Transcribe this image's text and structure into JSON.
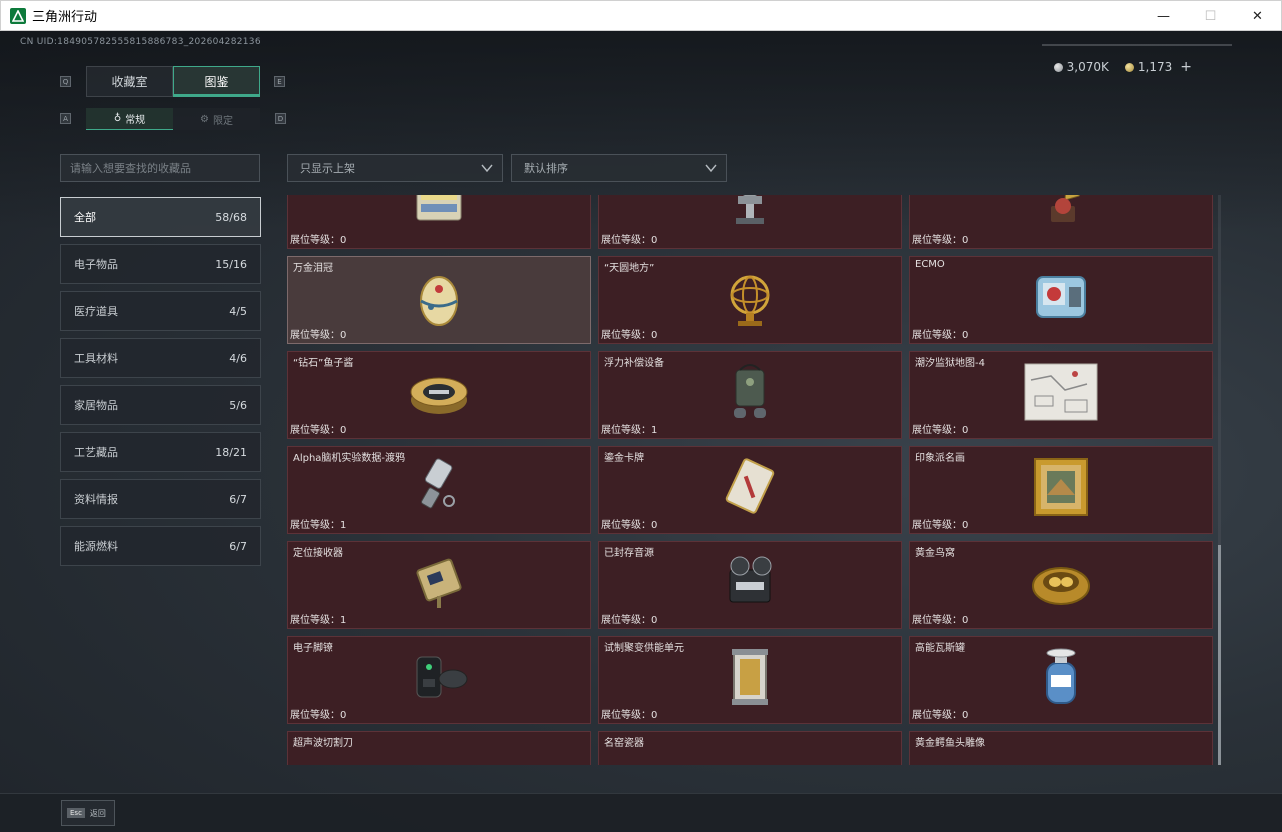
{
  "window": {
    "title": "三角洲行动",
    "minimize": "—",
    "maximize": "☐",
    "close": "✕"
  },
  "uid": "CN UID:184905782555815886783_202604282136",
  "currency": {
    "silver": "3,070K",
    "gold": "1,173",
    "add": "+"
  },
  "tabs": {
    "left_key": "Q",
    "right_key": "E",
    "items": [
      {
        "label": "收藏室"
      },
      {
        "label": "图鉴"
      }
    ]
  },
  "subtabs": {
    "left_key": "A",
    "right_key": "D",
    "items": [
      {
        "label": "常规"
      },
      {
        "label": "限定"
      }
    ]
  },
  "search": {
    "placeholder": "请输入想要查找的收藏品"
  },
  "filters": {
    "shelf": "只显示上架",
    "sort": "默认排序"
  },
  "categories": [
    {
      "label": "全部",
      "count": "58/68"
    },
    {
      "label": "电子物品",
      "count": "15/16"
    },
    {
      "label": "医疗道具",
      "count": "4/5"
    },
    {
      "label": "工具材料",
      "count": "4/6"
    },
    {
      "label": "家居物品",
      "count": "5/6"
    },
    {
      "label": "工艺藏品",
      "count": "18/21"
    },
    {
      "label": "资料情报",
      "count": "6/7"
    },
    {
      "label": "能源燃料",
      "count": "6/7"
    }
  ],
  "level_prefix": "展位等级：",
  "items": [
    {
      "name": "",
      "level": "0",
      "icon": "battery-pack-icon"
    },
    {
      "name": "",
      "level": "0",
      "icon": "robot-arm-icon"
    },
    {
      "name": "",
      "level": "0",
      "icon": "gramophone-icon"
    },
    {
      "name": "万金泪冠",
      "level": "0",
      "icon": "jeweled-egg-icon"
    },
    {
      "name": "“天圆地方”",
      "level": "0",
      "icon": "armillary-sphere-icon"
    },
    {
      "name": "ECMO",
      "level": "0",
      "icon": "ecmo-machine-icon"
    },
    {
      "name": "“钻石”鱼子酱",
      "level": "0",
      "icon": "caviar-tin-icon"
    },
    {
      "name": "浮力补偿设备",
      "level": "1",
      "icon": "buoyancy-device-icon"
    },
    {
      "name": "潮汐监狱地图-4",
      "level": "0",
      "icon": "map-icon"
    },
    {
      "name": "Alpha脑机实验数据-渡鸦",
      "level": "1",
      "icon": "data-drive-icon"
    },
    {
      "name": "鎏金卡牌",
      "level": "0",
      "icon": "gilded-card-icon"
    },
    {
      "name": "印象派名画",
      "level": "0",
      "icon": "framed-painting-icon"
    },
    {
      "name": "定位接收器",
      "level": "1",
      "icon": "locator-receiver-icon"
    },
    {
      "name": "已封存音源",
      "level": "0",
      "icon": "reel-recorder-icon"
    },
    {
      "name": "黄金鸟窝",
      "level": "0",
      "icon": "golden-nest-icon"
    },
    {
      "name": "电子脚镣",
      "level": "0",
      "icon": "electronic-shackle-icon"
    },
    {
      "name": "试制聚变供能单元",
      "level": "0",
      "icon": "fusion-cell-icon"
    },
    {
      "name": "高能瓦斯罐",
      "level": "0",
      "icon": "gas-canister-icon"
    },
    {
      "name": "超声波切割刀",
      "level": "",
      "icon": "ultrasonic-cutter-icon"
    },
    {
      "name": "名窑瓷器",
      "level": "",
      "icon": "porcelain-icon"
    },
    {
      "name": "黄金鳄鱼头雕像",
      "level": "",
      "icon": "gold-crocodile-icon"
    }
  ],
  "footer": {
    "key": "Esc",
    "label": "返回"
  }
}
